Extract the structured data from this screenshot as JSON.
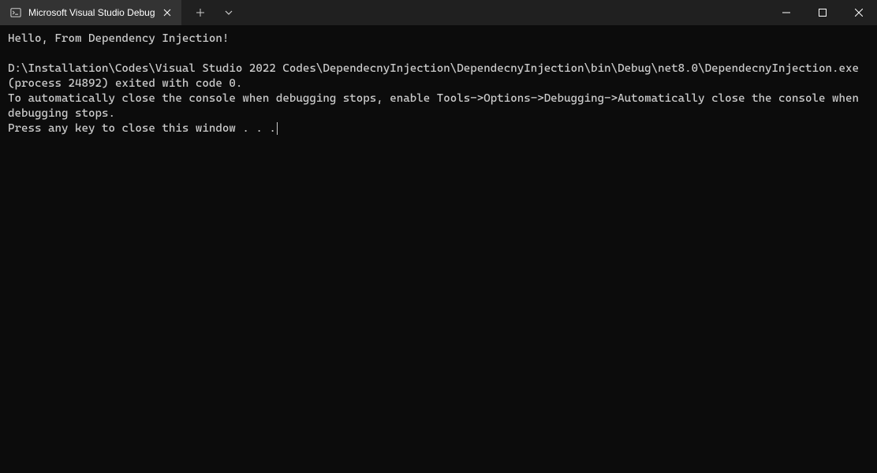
{
  "titlebar": {
    "tab": {
      "title": "Microsoft Visual Studio Debug"
    }
  },
  "console": {
    "line1": "Hello, From Dependency Injection!",
    "line2": "",
    "line3": "D:\\Installation\\Codes\\Visual Studio 2022 Codes\\DependecnyInjection\\DependecnyInjection\\bin\\Debug\\net8.0\\DependecnyInjection.exe (process 24892) exited with code 0.",
    "line4": "To automatically close the console when debugging stops, enable Tools->Options->Debugging->Automatically close the console when debugging stops.",
    "line5": "Press any key to close this window . . ."
  }
}
